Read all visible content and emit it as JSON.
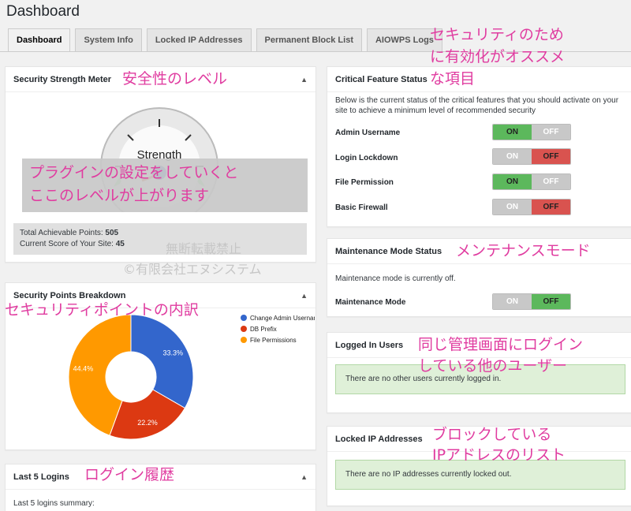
{
  "header": {
    "title": "Dashboard"
  },
  "tabs": [
    {
      "label": "Dashboard",
      "active": true
    },
    {
      "label": "System Info"
    },
    {
      "label": "Locked IP Addresses"
    },
    {
      "label": "Permanent Block List"
    },
    {
      "label": "AIOWPS Logs"
    }
  ],
  "strength": {
    "title": "Security Strength Meter",
    "gauge_label": "Strength",
    "total_label": "Total Achievable Points: ",
    "total_value": "505",
    "score_label": "Current Score of Your Site: ",
    "score_value": "45"
  },
  "breakdown": {
    "title": "Security Points Breakdown",
    "chart_data": {
      "type": "pie",
      "categories": [
        "Change Admin Username",
        "DB Prefix",
        "File Permissions"
      ],
      "values": [
        33.3,
        22.2,
        44.4
      ],
      "value_labels": [
        "33.3%",
        "22.2%",
        "44.4%"
      ],
      "colors": [
        "#3366cc",
        "#dc3912",
        "#ff9900"
      ],
      "legend_position": "right",
      "donut": true
    }
  },
  "logins": {
    "title": "Last 5 Logins",
    "summary": "Last 5 logins summary:"
  },
  "critical": {
    "title": "Critical Feature Status",
    "desc": "Below is the current status of the critical features that you should activate on your site to achieve a minimum level of recommended security",
    "on": "ON",
    "off": "OFF",
    "items": [
      {
        "label": "Admin Username",
        "state": "on"
      },
      {
        "label": "Login Lockdown",
        "state": "off"
      },
      {
        "label": "File Permission",
        "state": "on"
      },
      {
        "label": "Basic Firewall",
        "state": "off"
      }
    ]
  },
  "maintenance": {
    "title": "Maintenance Mode Status",
    "desc": "Maintenance mode is currently off.",
    "label": "Maintenance Mode",
    "on": "ON",
    "off": "OFF"
  },
  "logged_in": {
    "title": "Logged In Users",
    "message": "There are no other users currently logged in."
  },
  "locked_ip": {
    "title": "Locked IP Addresses",
    "message": "There are no IP addresses currently locked out."
  },
  "annotations": {
    "security_level": "安全性のレベル",
    "recommended_1": "セキュリティのため",
    "recommended_2": "に有効化がオススメ",
    "recommended_3": "な項目",
    "plugin_1": "プラグインの設定をしていくと",
    "plugin_2": "ここのレベルが上がります",
    "watermark_1": "無断転載禁止",
    "watermark_2": "©有限会社エヌシステム",
    "maintenance": "メンテナンスモード",
    "breakdown": "セキュリティポイントの内訳",
    "logged_1": "同じ管理画面にログイン",
    "logged_2": "している他のユーザー",
    "locked_1": "ブロックしている",
    "locked_2": "IPアドレスのリスト",
    "history": "ログイン履歴"
  }
}
